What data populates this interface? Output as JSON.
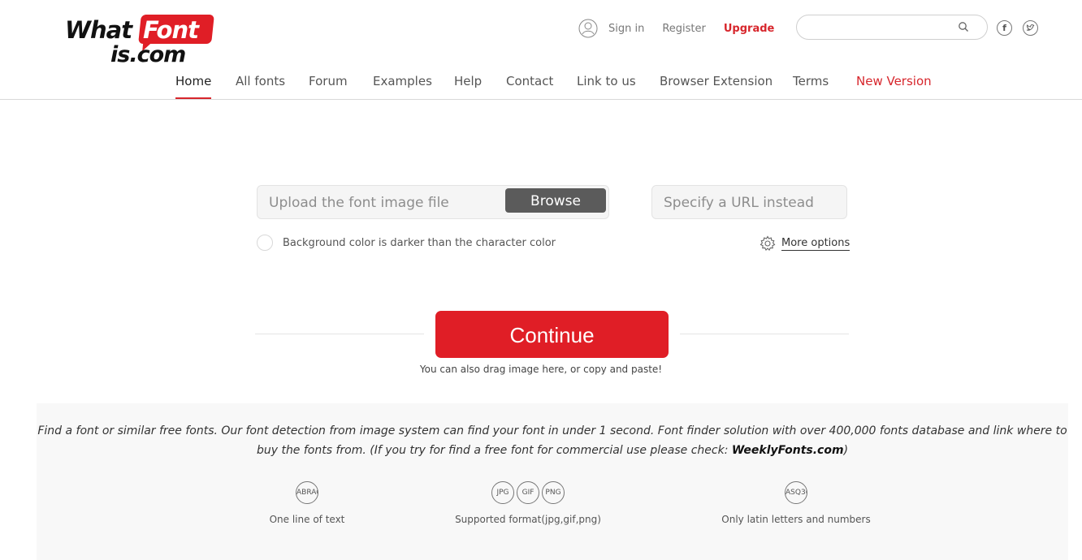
{
  "logo": {
    "line1": "What",
    "line1_highlight": "Font",
    "line2": "is.com"
  },
  "top_links": {
    "sign_in": "Sign in",
    "register": "Register",
    "upgrade": "Upgrade"
  },
  "search": {
    "placeholder": ""
  },
  "social": {
    "facebook": "f",
    "twitter": "t"
  },
  "nav": {
    "items": [
      "Home",
      "All fonts",
      "Forum",
      "Examples",
      "Help",
      "Contact",
      "Link to us",
      "Browser Extension",
      "Terms",
      "New Version"
    ],
    "active": "Home"
  },
  "upload": {
    "file_placeholder": "Upload the font image file",
    "browse_label": "Browse",
    "url_placeholder": "Specify a URL instead",
    "dark_bg_label": "Background color is darker than the character color",
    "more_options": "More options",
    "continue_label": "Continue",
    "drag_hint": "You can also drag image here, or copy and paste!"
  },
  "info": {
    "description": "Find a font or similar free fonts. Our font detection from image system can find your font in under 1 second. Font finder solution with over 400,000 fonts database and link where to buy the fonts from. (If you try for find a free font for commercial use please check: ",
    "link_text": "WeeklyFonts.com",
    "description_end": ")",
    "features": [
      {
        "circles": [
          "ABRACA"
        ],
        "caption": "One line of text"
      },
      {
        "circles": [
          "JPG",
          "GIF",
          "PNG"
        ],
        "caption": "Supported format(jpg,gif,png)"
      },
      {
        "circles": [
          "ASQ36"
        ],
        "caption": "Only latin letters and numbers"
      }
    ]
  },
  "colors": {
    "accent": "#e01e26",
    "browse": "#5b5b5b",
    "panel_bg": "#f8f8f8"
  }
}
